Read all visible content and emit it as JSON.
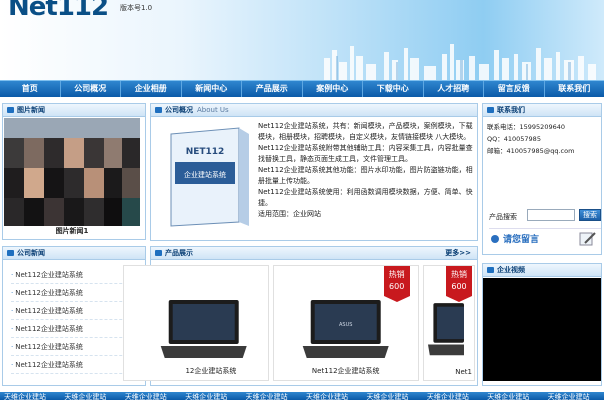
{
  "header": {
    "logo": "Net112",
    "version": "版本号1.0"
  },
  "nav": [
    "首页",
    "公司概况",
    "企业相册",
    "新闻中心",
    "产品展示",
    "案例中心",
    "下载中心",
    "人才招聘",
    "留言反馈",
    "联系我们"
  ],
  "photo_news": {
    "title": "图片新闻",
    "caption": "图片新闻1"
  },
  "company_news": {
    "title": "公司新闻",
    "items": [
      "Net112企业建站系统",
      "Net112企业建站系统",
      "Net112企业建站系统",
      "Net112企业建站系统",
      "Net112企业建站系统",
      "Net112企业建站系统"
    ]
  },
  "about": {
    "title": "公司概况",
    "subtitle": "About Us",
    "box_brand": "NET112",
    "box_label": "企业建站系统",
    "paragraphs": [
      "Net112企业建站系统，共有：新闻模块，产品模块，案例模块，下载模块，相册模块，招聘模块，自定义模块，友情链接模块 八大模块。",
      "Net112企业建站系统附带其他辅助工具：内容采集工具，内容批量查找替换工具，静态页面生成工具，文件管理工具。",
      "Net112企业建站系统其他功能：图片水印功能，图片防盗链功能，相册批量上传功能。",
      "Net112企业建站系统使用：利用函数调用模块数据，方便、简单、快捷。",
      "适用范围：企业网站"
    ]
  },
  "products": {
    "title": "产品展示",
    "more": "更多>>",
    "items": [
      {
        "tag": "",
        "price": "",
        "name": "12企业建站系统"
      },
      {
        "tag": "热销",
        "price": "600",
        "name": "Net112企业建站系统"
      },
      {
        "tag": "热销",
        "price": "600",
        "name": "Net1"
      }
    ]
  },
  "contact": {
    "title": "联系我们",
    "phone": "联系电话：15995209640",
    "qq": "QQ：410057985",
    "email": "邮箱：410057985@qq.com"
  },
  "search": {
    "label": "产品搜索",
    "button": "搜索",
    "value": ""
  },
  "guestbook": {
    "label": "请您留言"
  },
  "video": {
    "title": "企业视频"
  },
  "footer": [
    "天维企业建站",
    "天维企业建站",
    "天维企业建站",
    "天维企业建站",
    "天维企业建站",
    "天维企业建站",
    "天维企业建站",
    "天维企业建站",
    "天维企业建站",
    "天维企业建站"
  ],
  "colors": {
    "nav": "#0b5aa8",
    "accent": "#1e6fbf",
    "hot_tag": "#c8191e"
  }
}
